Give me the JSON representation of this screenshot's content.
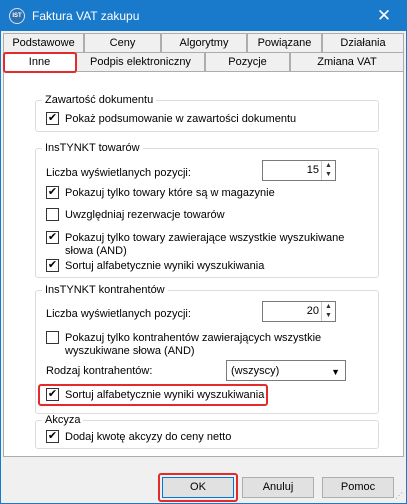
{
  "window": {
    "title": "Faktura VAT zakupu"
  },
  "tabs_top": [
    "Podstawowe",
    "Ceny",
    "Algorytmy",
    "Powiązane",
    "Działania"
  ],
  "tabs_bottom": [
    "Inne",
    "Podpis elektroniczny",
    "Pozycje",
    "Zmiana VAT"
  ],
  "zawartosc": {
    "legend": "Zawartość dokumentu",
    "show_summary": {
      "label": "Pokaż podsumowanie w zawartości dokumentu",
      "checked": true
    }
  },
  "towary": {
    "legend": "InsTYNKT towarów",
    "count_label": "Liczba wyświetlanych pozycji:",
    "count_value": "15",
    "only_in_stock": {
      "label": "Pokazuj tylko towary które są w magazynie",
      "checked": true
    },
    "include_reservations": {
      "label": "Uwzględniaj rezerwacje towarów",
      "checked": false
    },
    "all_words": {
      "label": "Pokazuj tylko towary zawierające wszystkie wyszukiwane słowa (AND)",
      "checked": true
    },
    "sort_alpha": {
      "label": "Sortuj alfabetycznie wyniki wyszukiwania",
      "checked": true
    }
  },
  "kontrahenci": {
    "legend": "InsTYNKT kontrahentów",
    "count_label": "Liczba wyświetlanych pozycji:",
    "count_value": "20",
    "all_words": {
      "label": "Pokazuj tylko kontrahentów zawierających wszystkie wyszukiwane słowa (AND)",
      "checked": false
    },
    "type_label": "Rodzaj kontrahentów:",
    "type_value": "(wszyscy)",
    "sort_alpha": {
      "label": "Sortuj alfabetycznie wyniki wyszukiwania",
      "checked": true
    }
  },
  "akcyza": {
    "legend": "Akcyza",
    "add_excise": {
      "label": "Dodaj kwotę akcyzy do ceny netto",
      "checked": true
    }
  },
  "buttons": {
    "ok": "OK",
    "cancel": "Anuluj",
    "help": "Pomoc"
  },
  "colors": {
    "titlebar": "#1979ca",
    "highlight": "#e32b2b"
  }
}
